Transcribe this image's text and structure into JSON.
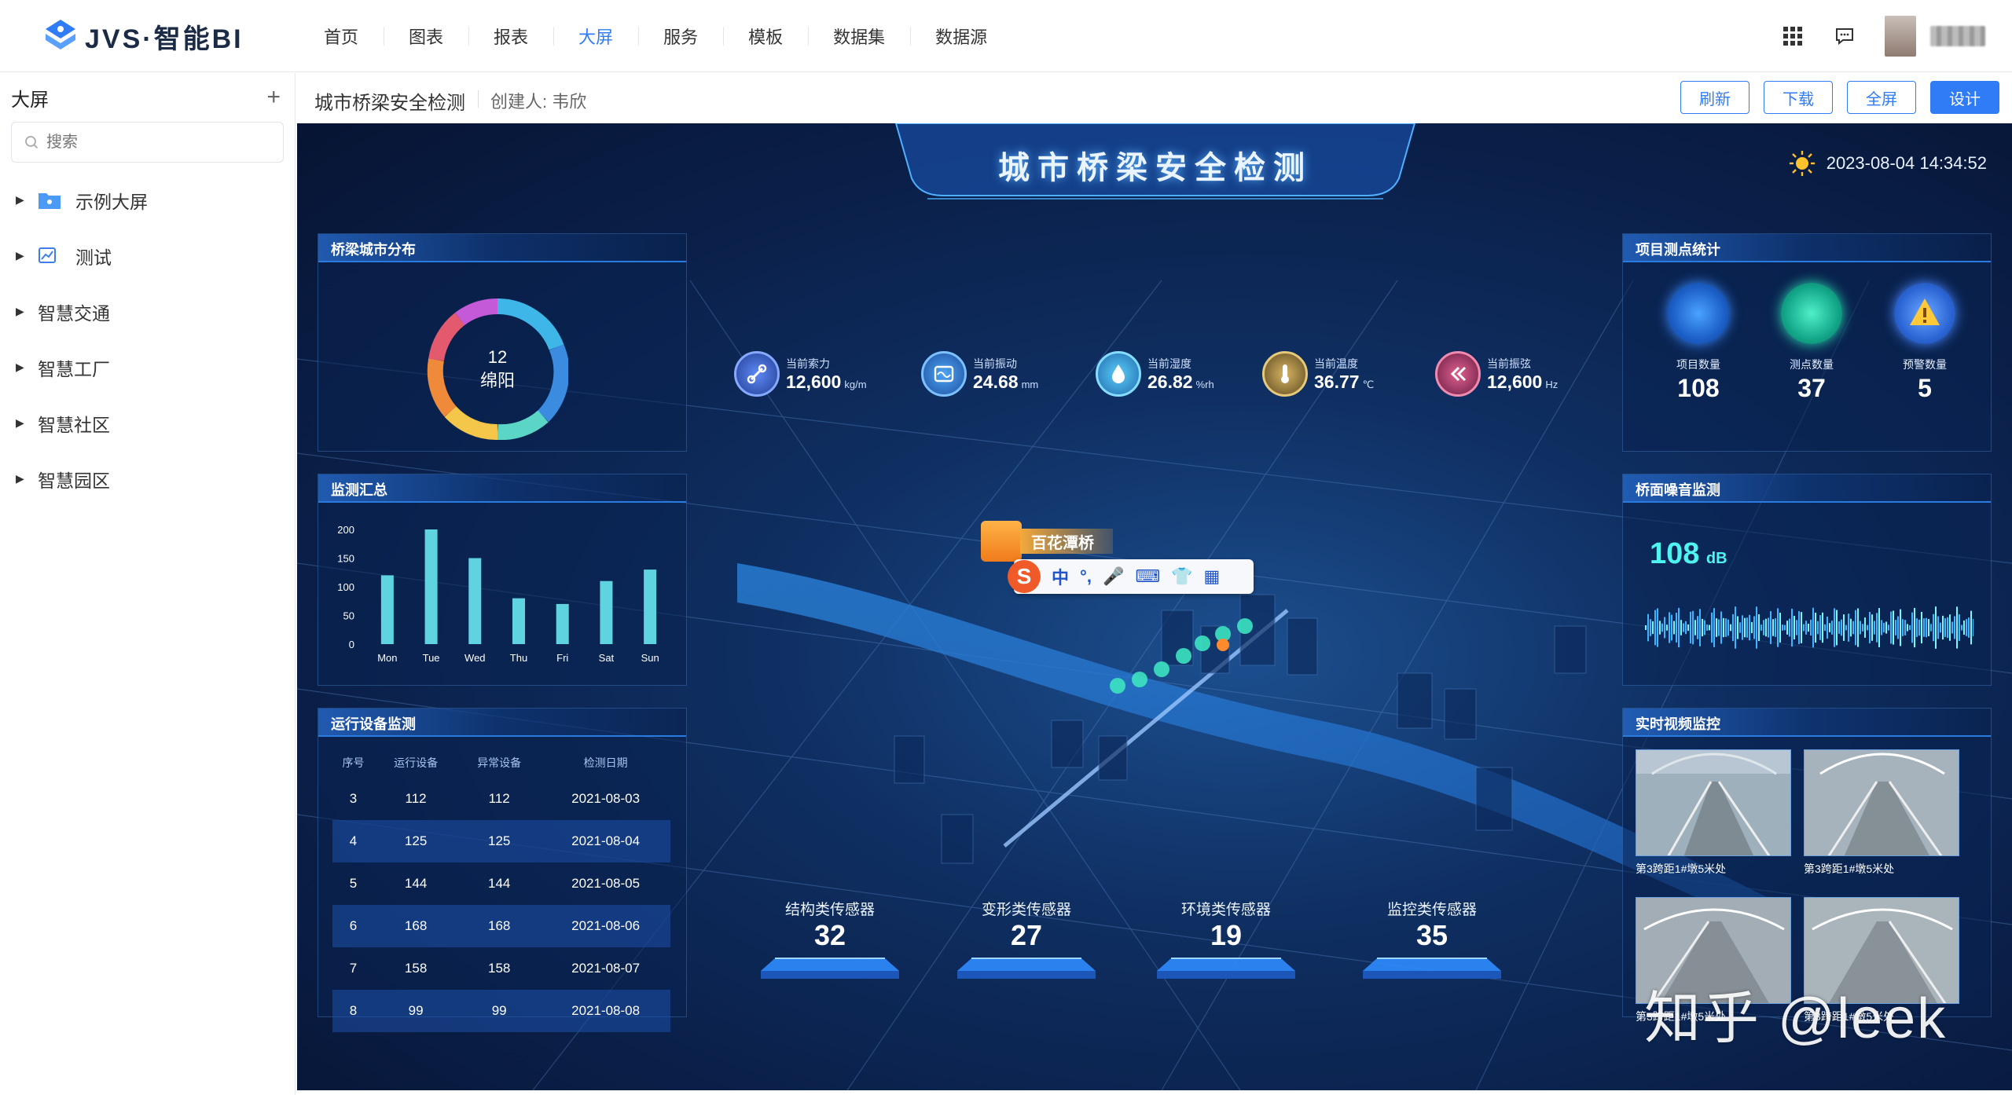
{
  "app": {
    "logo_text": "JVS·智能BI",
    "nav": [
      "首页",
      "图表",
      "报表",
      "大屏",
      "服务",
      "模板",
      "数据集",
      "数据源"
    ],
    "active_nav": "大屏"
  },
  "sidebar": {
    "title": "大屏",
    "add_label": "+",
    "search_placeholder": "搜索",
    "items": [
      {
        "label": "示例大屏",
        "icon": "folder-icon"
      },
      {
        "label": "测试",
        "icon": "dashboard-icon"
      },
      {
        "label": "智慧交通",
        "icon": ""
      },
      {
        "label": "智慧工厂",
        "icon": ""
      },
      {
        "label": "智慧社区",
        "icon": ""
      },
      {
        "label": "智慧园区",
        "icon": ""
      }
    ]
  },
  "subheader": {
    "page_title": "城市桥梁安全检测",
    "creator": "创建人:  韦欣",
    "buttons": {
      "refresh": "刷新",
      "download": "下载",
      "fullscreen": "全屏",
      "design": "设计"
    }
  },
  "dashboard": {
    "title": "城市桥梁安全检测",
    "datetime": "2023-08-04 14:34:52",
    "metrics": [
      {
        "label": "当前索力",
        "value": "12,600",
        "unit": "kg/m",
        "color": "#3b6fe0"
      },
      {
        "label": "当前振动",
        "value": "24.68",
        "unit": "mm",
        "color": "#2d8fe6"
      },
      {
        "label": "当前湿度",
        "value": "26.82",
        "unit": "%rh",
        "color": "#2ab0ef"
      },
      {
        "label": "当前温度",
        "value": "36.77",
        "unit": "℃",
        "color": "#c9a24a"
      },
      {
        "label": "当前振弦",
        "value": "12,600",
        "unit": "Hz",
        "color": "#d9457a"
      }
    ],
    "city_panel": {
      "title": "桥梁城市分布",
      "donut_value": "12",
      "donut_label": "绵阳"
    },
    "monitor_panel": {
      "title": "监测汇总"
    },
    "device_panel": {
      "title": "运行设备监测",
      "columns": [
        "序号",
        "运行设备",
        "异常设备",
        "检测日期"
      ],
      "rows": [
        [
          "3",
          "112",
          "112",
          "2021-08-03"
        ],
        [
          "4",
          "125",
          "125",
          "2021-08-04"
        ],
        [
          "5",
          "144",
          "144",
          "2021-08-05"
        ],
        [
          "6",
          "168",
          "168",
          "2021-08-06"
        ],
        [
          "7",
          "158",
          "158",
          "2021-08-07"
        ],
        [
          "8",
          "99",
          "99",
          "2021-08-08"
        ]
      ]
    },
    "project_panel": {
      "title": "项目测点统计",
      "stats": [
        {
          "label": "项目数量",
          "value": "108",
          "color": "#2d7ff0"
        },
        {
          "label": "测点数量",
          "value": "37",
          "color": "#1fc2a0"
        },
        {
          "label": "预警数量",
          "value": "5",
          "color": "#3a6fd8"
        }
      ]
    },
    "noise_panel": {
      "title": "桥面噪音监测",
      "value": "108",
      "unit": "dB"
    },
    "video_panel": {
      "title": "实时视频监控",
      "captions": [
        "第3跨距1#墩5米处",
        "第3跨距1#墩5米处",
        "第3跨距1#墩5米处",
        "第3跨距1#墩5米处"
      ]
    },
    "sensors": [
      {
        "label": "结构类传感器",
        "value": "32"
      },
      {
        "label": "变形类传感器",
        "value": "27"
      },
      {
        "label": "环境类传感器",
        "value": "19"
      },
      {
        "label": "监控类传感器",
        "value": "35"
      }
    ],
    "bridge_label": "百花潭桥",
    "ime_glyphs": [
      "中",
      "°,",
      "🎤",
      "⌨",
      "👕",
      "▦"
    ],
    "watermark": "知乎 @leek"
  },
  "chart_data": {
    "type": "bar",
    "title": "",
    "categories": [
      "Mon",
      "Tue",
      "Wed",
      "Thu",
      "Fri",
      "Sat",
      "Sun"
    ],
    "values": [
      120,
      200,
      150,
      80,
      70,
      110,
      130
    ],
    "ylim": [
      0,
      200
    ],
    "yticks": [
      0,
      50,
      100,
      150,
      200
    ],
    "color": "#5fd3e0"
  }
}
